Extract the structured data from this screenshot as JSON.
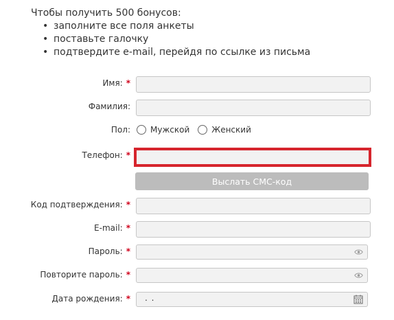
{
  "intro": {
    "heading": "Чтобы получить 500 бонусов:",
    "bullets": [
      "заполните все поля анкеты",
      "поставьте галочку",
      "подтвердите e-mail, перейдя по ссылке из письма"
    ]
  },
  "form": {
    "required_mark": "*",
    "name": {
      "label": "Имя:",
      "value": ""
    },
    "surname": {
      "label": "Фамилия:",
      "value": ""
    },
    "gender": {
      "label": "Пол:",
      "options": [
        "Мужской",
        "Женский"
      ]
    },
    "phone": {
      "label": "Телефон:",
      "value": ""
    },
    "sms_button": {
      "label": "Выслать СМС-код"
    },
    "confirm_code": {
      "label": "Код подтверждения:",
      "value": ""
    },
    "email": {
      "label": "E-mail:",
      "value": ""
    },
    "password": {
      "label": "Пароль:",
      "value": ""
    },
    "password_repeat": {
      "label": "Повторите пароль:",
      "value": ""
    },
    "birthdate": {
      "label": "Дата рождения:",
      "value": ". ."
    }
  },
  "colors": {
    "required": "#d0021b",
    "error_border": "#d6252d",
    "button_bg": "#bcbcbc"
  },
  "icons": {
    "password_toggle": "eye-icon",
    "date_picker": "calendar-icon"
  }
}
